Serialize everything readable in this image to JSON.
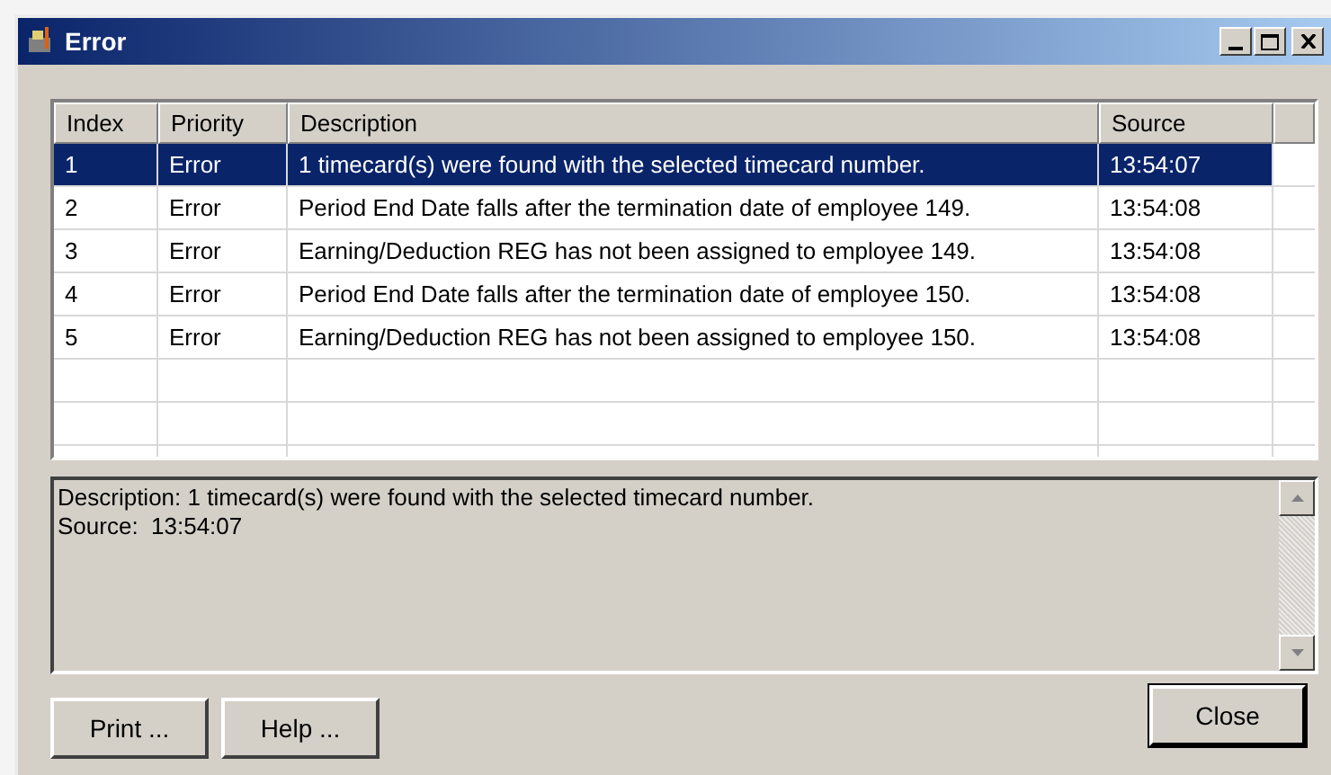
{
  "window": {
    "title": "Error"
  },
  "table": {
    "columns": [
      "Index",
      "Priority",
      "Description",
      "Source"
    ],
    "rows": [
      {
        "index": "1",
        "priority": "Error",
        "description": "1 timecard(s) were found with the selected timecard number.",
        "source": "13:54:07",
        "selected": true
      },
      {
        "index": "2",
        "priority": "Error",
        "description": "Period End Date falls after the termination date of employee 149.",
        "source": "13:54:08",
        "selected": false
      },
      {
        "index": "3",
        "priority": "Error",
        "description": "Earning/Deduction REG has not been assigned to employee 149.",
        "source": "13:54:08",
        "selected": false
      },
      {
        "index": "4",
        "priority": "Error",
        "description": "Period End Date falls after the termination date of employee 150.",
        "source": "13:54:08",
        "selected": false
      },
      {
        "index": "5",
        "priority": "Error",
        "description": "Earning/Deduction REG has not been assigned to employee 150.",
        "source": "13:54:08",
        "selected": false
      }
    ]
  },
  "details": [
    "Description: 1 timecard(s) were found with the selected timecard number.",
    "Source:  13:54:07"
  ],
  "buttons": {
    "left": [
      "Print ...",
      "Help ..."
    ],
    "right": "Close"
  }
}
